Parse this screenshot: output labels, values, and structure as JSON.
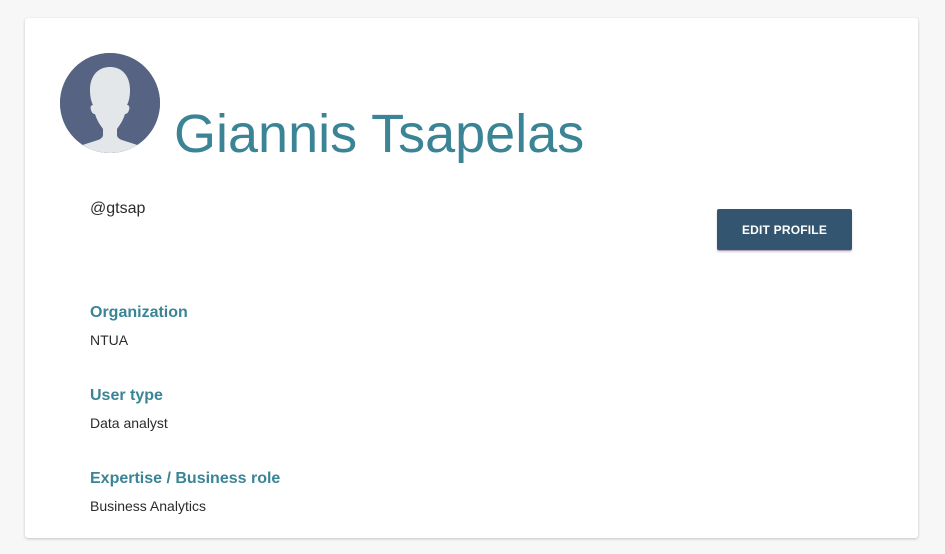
{
  "profile": {
    "name": "Giannis Tsapelas",
    "username": "@gtsap",
    "avatar_icon": "default-user-avatar-icon",
    "edit_button_label": "EDIT PROFILE"
  },
  "fields": [
    {
      "label": "Organization",
      "value": "NTUA"
    },
    {
      "label": "User type",
      "value": "Data analyst"
    },
    {
      "label": "Expertise / Business role",
      "value": "Business Analytics"
    }
  ],
  "colors": {
    "accent": "#3a8496",
    "button": "#34556f",
    "avatar_bg": "#566383",
    "avatar_figure": "#e4e7ea"
  }
}
